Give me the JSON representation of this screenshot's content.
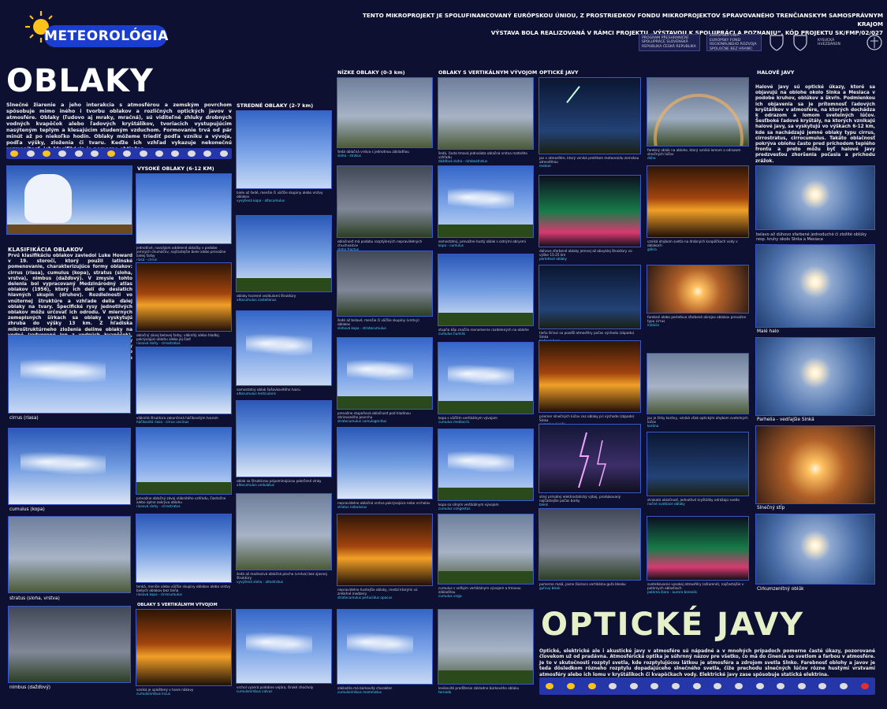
{
  "header": {
    "logo_text": "METEOROLÓGIA",
    "project_line1": "TENTO MIKROPROJEKT JE SPOLUFINANCOVANÝ EURÓPSKOU ÚNIOU, Z PROSTRIEDKOV FONDU MIKROPROJEKTOV SPRAVOVANÉHO TRENČIANSKYM SAMOSPRÁVNYM KRAJOM",
    "project_line2": "VÝSTAVA BOLA REALIZOVANÁ V RÁMCI PROJEKTU „VÝSTAVOU K SPOLUPRÁCI A POZNANIU“, KÓD PROJEKTU SK/FMP/02/027",
    "partners": [
      "PROGRAM PŘESHRANIČNÍ SPOLUPRÁCE SLOVENSKÁ REPUBLIKA ČESKÁ REPUBLIKA",
      "EURÓPSKA ÚNIA EURÓPSKY FOND REGIONÁLNEHO ROZVOJA SPOLOČNE BEZ HRANÍC",
      "KYSUCKÁ HVEZDÁREŇ"
    ]
  },
  "oblaky": {
    "title": "OBLAKY",
    "intro": "Slnečné žiarenie a jeho interakcia s atmosférou a zemským povrchom spôsobuje mimo iného i tvorbu oblakov a rozličných optických javov v atmosfére. Oblaky (ľudovo aj mraky, mračná), sú viditeľné zhluky drobných vodných kvapôčok alebo ľadových kryštálikov, tvoriacich vystupujúcim nasýteným teplým a klesajúcim studeným vzduchom. Formovanie trvá od pár minút až po niekoľko hodín. Oblaky môžeme triediť podľa vzniku a vývoja, podľa výšky, zloženia či tvaru. Keďže ich vzhľad vykazuje nekonečnú rozmanitosť, ich klasifikácia je pomerne obtiažna.",
    "klas_heading": "KLASIFIKÁCIA OBLAKOV",
    "klas_text": "Prvú klasifikáciu oblakov zaviedol Luke Howard v 19. storočí, ktorý použil latinské pomenovanie, charakterizujúce formy oblakov: cirrus (riasa), cumulus (kopa), stratus (sloha, vrstva), nimbus (dažďový). V zmysle tohto delenia bol vypracovaný Medzinárodný atlas oblakov (1956), ktorý ich delí do desiatich hlavných skupín (druhov). Rozdielnosti vo vnútornej štruktúre a vzhľade delia ďalej oblaky na tvary. Špecifické rysy jednotlivých oblakov môžu určovať ich odrodu. V miernych zemepisných šírkach sa oblaky vyskytujú zhruba do výšky 13 km. Z hľadiska mikroštruktúrneho zloženia delíme oblaky na vodné (vytvorené len z vodných kvapôčok), oblaky zmiešané (podchladené kvapôčky vody premiešané s ľadovými časticami) a oblaky ľadové. Podľa intervalu výšky najčastejšieho výskytu sú oblaky delené na tri vertikálne skupiny.",
    "labels": [
      "cirrus (riasa)",
      "cumulus (kopa)",
      "stratus (sloha, vrstva)",
      "nimbus (dažďový)"
    ]
  },
  "columns": {
    "vysoke": "VYSOKÉ OBLAKY (6-12 KM)",
    "stredne": "STREDNÉ OBLAKY (2-7 km)",
    "nizke": "NÍZKE OBLAKY (0-3 km)",
    "vertikal": "OBLAKY S VERTIKÁLNYM VÝVOJOM",
    "vertikal2": "OBLAKY S VERTIKÁLNYM VÝVOJOM",
    "opticke": "OPTICKÉ JAVY",
    "halove": "HALOVÉ JAVY"
  },
  "captions": {
    "vys1": [
      "jednotlivé, navzájom oddelené oblačky v podobe jemných chumáčov, najčastejšie biele alebo prevažne bielej farby",
      "riasa - cirrus"
    ],
    "vys2": [
      "oblačný závoj belavej farby, vláknitý alebo hladký, pokrývajúci oblohu alebo jej časť",
      "riasová slohy - cirrostratus"
    ],
    "vys3": [
      "vláknitá štruktúra zakončená háčikovitým tvarom",
      "háčikovitá riasa - cirrus uncinus"
    ],
    "vys4": [
      "prevažne oblačný závoj vláknitého vzhľadu, čiastočne alebo úplne zakrýva oblohu",
      "riasová slohy - cirrostratus"
    ],
    "vys5": [
      "tenká, menšie alebo väčšie skupiny oblakov alebo vrstvy bielych oblakov bez tieňa",
      "riasová kopa - cirrocumulus"
    ],
    "str1": [
      "biele až šedé, menšie či väčšie skupiny alebo vrstvy oblakov",
      "vyvýšená kopa - altocumulus"
    ],
    "str2": [
      "oblaky tvorené vezikulami štruktúry",
      "altocumulus castellanus"
    ],
    "str3": [
      "samostatný oblak šošovkovitého tvaru",
      "altocumulus lenticularis"
    ],
    "str4": [
      "oblak so štruktúrou pripomínajúcou pokrčené vlnky",
      "altocumulus undulatus"
    ],
    "str5": [
      "šedá až modrosivá oblačná plocha (vrstva) bez zjavnej štruktúry",
      "vyvýšená sloha - altostratus"
    ],
    "niz1": [
      "šedá oblačná vrstva s jednotnou základňou",
      "sloha - stratus"
    ],
    "niz2": [
      "oblačnosť má podobu rozptýlených nepravidelných chuchvalcov",
      "sloha fractus"
    ],
    "niz3": [
      "šedé až belavé, menšie či väčšie skupiny (vrstvy) oblakov",
      "slohová kopa - stratocumulus"
    ],
    "niz4": [
      "prevažne stupeňová oblačnosť pod hladinou ohrievaného povrchu",
      "stratocumulus cumulogenitus"
    ],
    "niz5": [
      "nepravidelne oblačná vrstva pokrývajúca nebo vrcholov",
      "stratus nebulosus"
    ],
    "niz6": [
      "nepravidelne hustejšie oblaky, medzi ktorými sú zreteľné medzery",
      "stratocumulus perlucidus opacus"
    ],
    "niz7": [
      "základňa má búrkovitý charakter",
      "cumulonimbus mammatus"
    ],
    "ver1": [
      "šedá, často tmavá jednoliata oblačná vrstva matného vzhľadu",
      "dažďová sloha - nimbostratus"
    ],
    "ver2": [
      "samostatný, prevažne hustý oblak s ostrými obrysmi",
      "kopa - cumulus"
    ],
    "ver3": [
      "stupňa kôp značila rovnomerne rozdelených na oblohe",
      "cumulus humilis"
    ],
    "ver4": [
      "kopa s väčším vertikálnym vývojom",
      "cumulus mediocris"
    ],
    "ver5": [
      "kopa so silným vertikálnym vývojom",
      "cumulus congestus"
    ],
    "ver6": [
      "cumulus s veľkým vertikálnym vývojom a tmavou základňou",
      "cumulus virga"
    ],
    "ver7": [
      "levikovité predĺženie základne búrkového oblaku",
      "tornado"
    ],
    "vv1": [
      "vzniká je splošťený v tvare nákovy",
      "cumulonimbus incus"
    ],
    "vv2": [
      "vrchol vyzerá podobne vejára, široké chocholy",
      "cumulonimbus calvus"
    ],
    "opt1": [
      "jav v atmosfére, ktorý vzniká prelétom meteoroidu zemskou atmosférou",
      "meteor"
    ],
    "opt2": [
      "dúhovo sfarbené oblaky jemnej až obvyklej štruktúry vo výške 15-25 km",
      "perleťové oblaky"
    ],
    "opt3": [
      "tieňa šíriaci sa pozdĺž atmosféry počas východu (západu) Slnka",
      "tieňová hora"
    ],
    "opt4": [
      "priemer slnečných lúčov cez oblaky pri východe (západe) Slnka",
      "súmrakové lúče"
    ],
    "opt5": [
      "silný prírodný elektrostatický výboj, produkovaný najčastejšie počas búrky",
      "blesk"
    ],
    "opt6": [
      "pomerne malá, jasne žiariaca vertikálna guľa blesku",
      "guľový blesk"
    ],
    "opt7": [
      "farebný oblúk na oblohe, ktorý vzniká lomom a odrazom slnečných lúčov",
      "dúha"
    ],
    "opt8": [
      "vzniká ohybom svetla na drobných kvapôčkach vody v oblakoch",
      "glória"
    ],
    "opt9": [
      "farebné alebo perleťovo sfarbené okrajov oblakov prevažne typu cirrus",
      "irizácia"
    ],
    "opt10": [
      "jav je šírky koróny, vzniká však optickým ohybom svetelných lúčov",
      "koróna"
    ],
    "opt11": [
      "strakatá oblačnosť, jednotlivé kryštáliky odrážajú svetlo",
      "nočné svietiace oblaky"
    ],
    "opt12": [
      "svetelkovanie vysokej atmosféry (ožiarené), najčastejšie v polárnych oblastiach",
      "polárna žiara - aurora borealis"
    ]
  },
  "halo": {
    "text": "Halové javy sú optické úkazy, ktoré sa objavujú na oblohe okolo Slnka a Mesiaca v podobe kruhov, oblúkov a škvŕn. Podmienkou ich objavenia sa je prítomnosť ľadových kryštálikov v atmosfére, na ktorých dochádza k odrazom a lomom svetelných lúčov. Šesťboké ľadové kryštály, na ktorých vznikajú halové javy, sa vyskytujú vo výškach 6-12 km, kde sa nachádzajú jemné oblaky typu cirrus, cirrostratus, cirrocumulus. Takáto oblačnosť pokrýva oblohu často pred príchodom teplého frontu a preto môžu byť halové javy predzvesťou zhoršenia počasia a príchodu zrážok.",
    "labels": [
      "belavo až dúhovo sfarbené jednoduché či zložité oblúky resp. kruhy okolo Slnka a Mesiaca",
      "Malé halo",
      "Parhelia - vedľajšie Slnká",
      "Slnečný stĺp",
      "Cirkumzenitný oblúk"
    ]
  },
  "opticke": {
    "title": "OPTICKÉ JAVY",
    "text": "Optické, elektrické ale i akustické javy v atmosfére sú nápadné a v mnohých prípadoch pomerne časté úkazy, pozorované človekom už od pradávna. Atmosférická optika je súhrnný názov pre všetko, čo má do činenia so svetlom a farbou v atmosfére. Je to v skutočnosti rozptyl svetla, kde rozptylujúcou látkou je atmosféra a zdrojom svetla Slnko. Farebnosť oblohy a javov je teda dôsledkom rôzneho rozptylu dopadajúceho slnečného svetla, čiže prechodu slnečných lúčov rôzne hustými vrstvami atmosféry alebo ich lomu v kryštálikoch či kvapôčkach vody. Elektrické javy zase spôsobuje statická elektrina."
  },
  "colors": {
    "background": "#0d1030",
    "accent": "#1a3fd0",
    "caption_label": "#4fd2ff",
    "photo_border": "#3a58c8"
  }
}
